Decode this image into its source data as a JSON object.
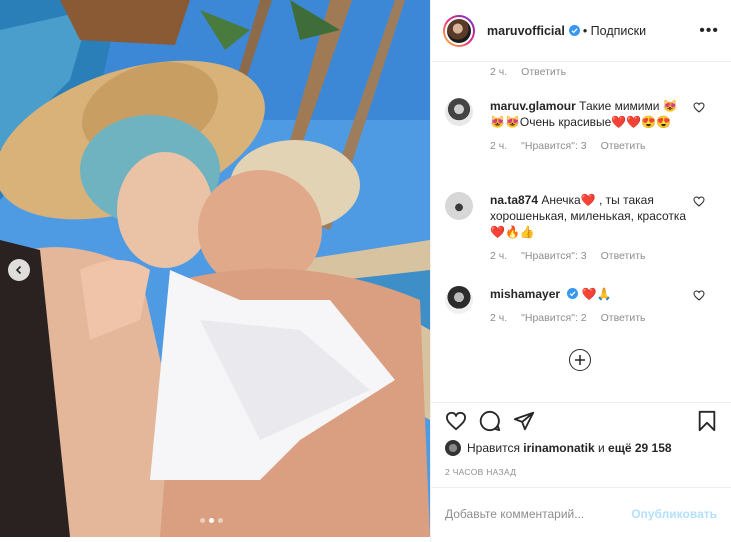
{
  "post": {
    "author": "maruvofficial",
    "follow_label": "• Подписки",
    "more_icon": "more-horizontal-icon",
    "carousel_count": 3,
    "carousel_active_index": 1
  },
  "comments": {
    "top_partial": {
      "time": "2 ч.",
      "reply": "Ответить"
    },
    "items": [
      {
        "user": "maruv.glamour",
        "text": "Такие мимими 😻😻😻Очень красивые❤️❤️😍😍",
        "time": "2 ч.",
        "likes": "\"Нравится\": 3",
        "reply": "Ответить"
      },
      {
        "user": "na.ta874",
        "text": "Анечка❤️ , ты такая хорошенькая, миленькая, красотка❤️🔥👍",
        "time": "2 ч.",
        "likes": "\"Нравится\": 3",
        "reply": "Ответить"
      },
      {
        "user": "mishamayer",
        "text": "❤️🙏",
        "time": "2 ч.",
        "likes": "\"Нравится\": 2",
        "reply": "Ответить"
      }
    ]
  },
  "likes": {
    "prefix": "Нравится",
    "user": "irinamonatik",
    "and": "и",
    "others": "ещё 29 158"
  },
  "timestamp": "2 ЧАСОВ НАЗАД",
  "composer": {
    "placeholder": "Добавьте комментарий...",
    "publish": "Опубликовать"
  },
  "colors": {
    "verified": "#3897f0",
    "publish_disabled": "#b2dffc",
    "meta": "#8e8e8e"
  }
}
